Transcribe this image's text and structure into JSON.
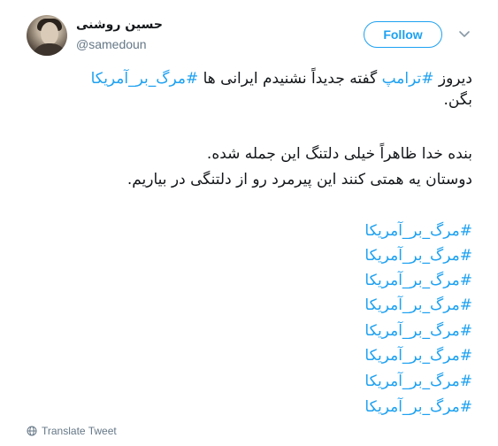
{
  "author": {
    "name": "حسین روشنی",
    "handle": "@samedoun"
  },
  "follow_label": "Follow",
  "tweet": {
    "line1_part1": "دیروز ",
    "line1_hashtag1": "#ترامپ",
    "line1_part2": " گفته جدیداً نشنیدم ایرانی ها ",
    "line1_hashtag2": "#مرگ_بر_آمریکا",
    "line2": "بگن.",
    "line3": "بنده خدا ظاهراً خیلی دلتنگ این جمله شده.",
    "line4": "دوستان یه همتی کنند این پیرمرد رو از دلتنگی در بیاریم.",
    "hashtags": [
      "#مرگ_بر_آمریکا",
      "#مرگ_بر_آمریکا",
      "#مرگ_بر_آمریکا",
      "#مرگ_بر_آمریکا",
      "#مرگ_بر_آمریکا",
      "#مرگ_بر_آمریکا",
      "#مرگ_بر_آمریکا",
      "#مرگ_بر_آمریکا"
    ]
  },
  "translate_label": "Translate Tweet",
  "colors": {
    "accent": "#1da1f2",
    "text": "#14171a",
    "muted": "#657786"
  }
}
